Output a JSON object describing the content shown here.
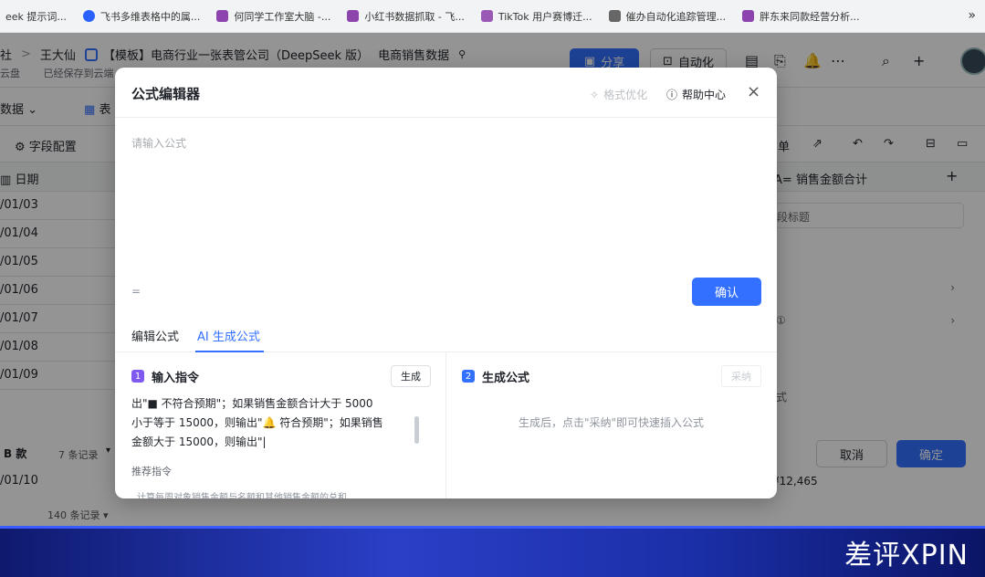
{
  "bookmarks": [
    {
      "label": "eek 提示词...",
      "color": "#1e88e5"
    },
    {
      "label": "飞书多维表格中的属...",
      "color": "#2962ff"
    },
    {
      "label": "何同学工作室大脑 -...",
      "color": "#8e44ad"
    },
    {
      "label": "小红书数据抓取 - 飞...",
      "color": "#8e44ad"
    },
    {
      "label": "TikTok 用户赛博迁...",
      "color": "#9b59b6"
    },
    {
      "label": "催办自动化追踪管理...",
      "color": "#555555"
    },
    {
      "label": "胖东来同款经营分析...",
      "color": "#8e44ad"
    }
  ],
  "bookmarks_more": "»",
  "header": {
    "crumb_root": "社",
    "crumb_sep": ">",
    "crumb_user": "王大仙",
    "doc_title": "【模板】电商行业一张表管公司（DeepSeek 版）",
    "table_title": "电商销售数据",
    "saved_left": "云盘",
    "saved_text": "已经保存到云端",
    "share": "分享",
    "automation": "自动化"
  },
  "view": {
    "name": "数据",
    "table": "表"
  },
  "toolbar": {
    "field_config": "字段配置",
    "form_suffix": "单"
  },
  "columns": {
    "date": "日期",
    "sales_total": "销售金额合计"
  },
  "rows": [
    "/01/03",
    "/01/04",
    "/01/05",
    "/01/06",
    "/01/07",
    "/01/08",
    "/01/09"
  ],
  "group": {
    "name": "B 款",
    "count": "7 条记录"
  },
  "row_after": "/01/10",
  "total_count": "140 条记录",
  "side_panel": {
    "title_placeholder": "段标题",
    "desc_icon": "①",
    "formula_label": "式",
    "cell_value": "¥12,465"
  },
  "footer": {
    "cancel": "取消",
    "ok": "确定"
  },
  "modal": {
    "title": "公式编辑器",
    "format": "格式优化",
    "help": "帮助中心",
    "input_placeholder": "请输入公式",
    "eq": "=",
    "confirm": "确认",
    "tabs": [
      "编辑公式",
      "AI 生成公式"
    ],
    "left": {
      "num": "1",
      "title": "输入指令",
      "gen": "生成",
      "lines": [
        "出\"■ 不符合预期\"；如果销售金额合计大于 5000",
        "小于等于 15000，则输出\"🔔 符合预期\"；如果销售",
        "金额大于 15000，则输出\"|"
      ],
      "recommend": "推荐指令",
      "recommend_item": "计算每周对象销售金额与名额和其他销售金额的总和"
    },
    "right": {
      "num": "2",
      "title": "生成公式",
      "adopt": "采纳",
      "hint": "生成后，点击\"采纳\"即可快速插入公式"
    }
  },
  "banner": {
    "text": "差评XPIN"
  },
  "colors": {
    "accent": "#3370ff",
    "banner": "#1b2fa8"
  }
}
